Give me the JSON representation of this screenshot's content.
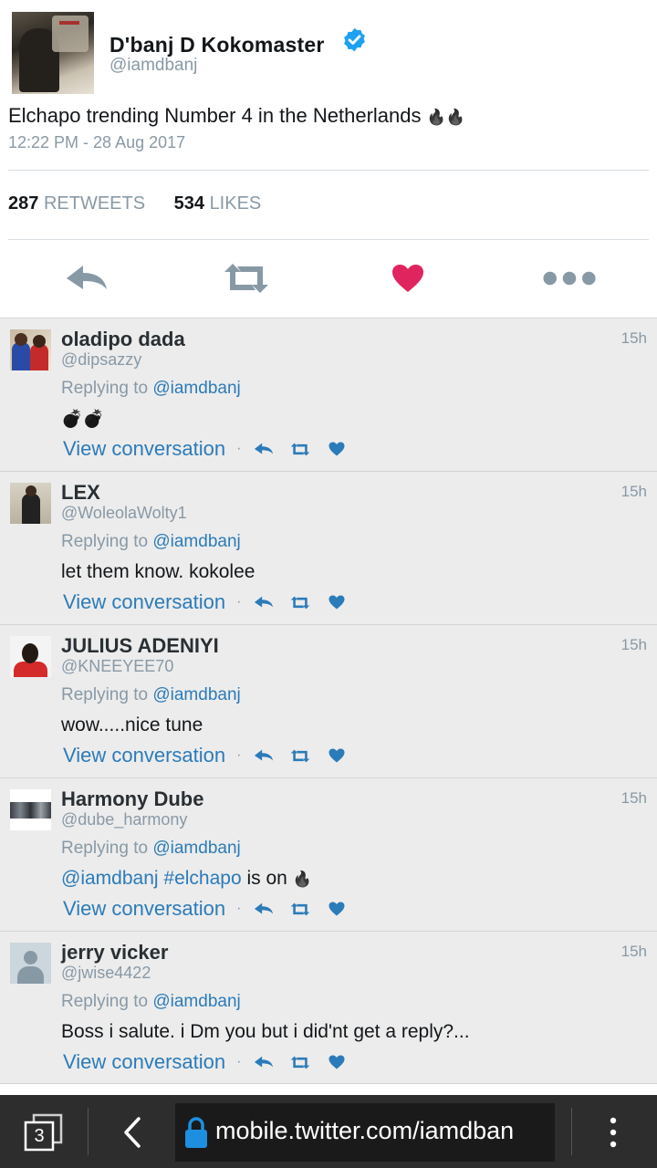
{
  "main_tweet": {
    "name": "D'banj D Kokomaster",
    "handle": "@iamdbanj",
    "text": "Elchapo trending Number 4 in the Netherlands",
    "emoji": "🔥🔥",
    "timestamp": "12:22 PM - 28 Aug 2017",
    "retweets_count": "287",
    "retweets_label": "RETWEETS",
    "likes_count": "534",
    "likes_label": "LIKES",
    "colors": {
      "like": "#e0245e",
      "action_gray": "#8899a6",
      "verified": "#1da1f2"
    }
  },
  "replies": [
    {
      "name": "oladipo dada",
      "handle": "@dipsazzy",
      "time": "15h",
      "replying_prefix": "Replying to",
      "replying_to": "@iamdbanj",
      "text": "💣💣",
      "view_conversation": "View conversation"
    },
    {
      "name": "LEX",
      "handle": "@WoleolaWolty1",
      "time": "15h",
      "replying_prefix": "Replying to",
      "replying_to": "@iamdbanj",
      "text": "let them know. kokolee",
      "view_conversation": "View conversation"
    },
    {
      "name": "JULIUS ADENIYI",
      "handle": "@KNEEYEE70",
      "time": "15h",
      "replying_prefix": "Replying to",
      "replying_to": "@iamdbanj",
      "text": "wow.....nice tune",
      "view_conversation": "View conversation"
    },
    {
      "name": "Harmony Dube",
      "handle": "@dube_harmony",
      "time": "15h",
      "replying_prefix": "Replying to",
      "replying_to": "@iamdbanj",
      "text_mention": "@iamdbanj",
      "text_hashtag": "#elchapo",
      "text_rest": "is on",
      "text_emoji": "🔥",
      "view_conversation": "View conversation"
    },
    {
      "name": "jerry vicker",
      "handle": "@jwise4422",
      "time": "15h",
      "replying_prefix": "Replying to",
      "replying_to": "@iamdbanj",
      "text": "Boss i salute. i Dm you but i did'nt get a reply?...",
      "view_conversation": "View conversation"
    }
  ],
  "browser_bar": {
    "tab_count": "3",
    "url": "mobile.twitter.com/iamdban"
  }
}
